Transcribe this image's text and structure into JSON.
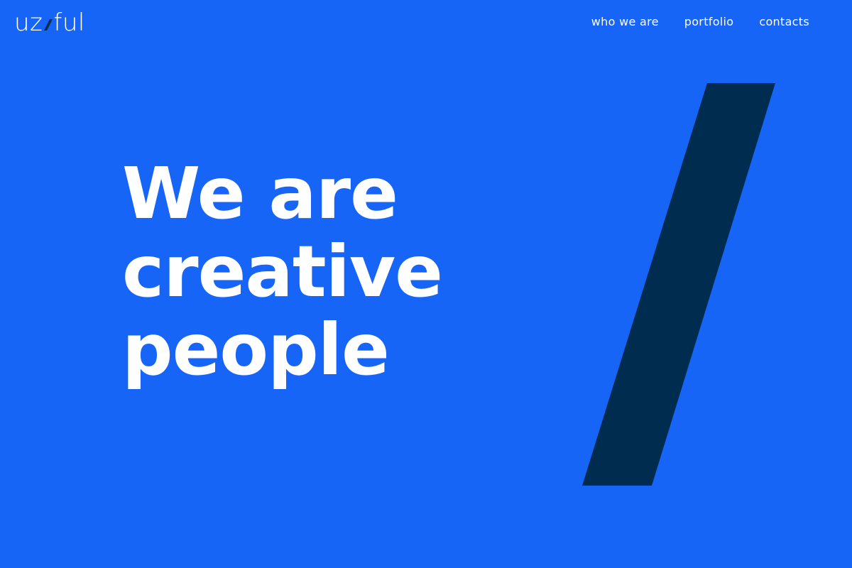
{
  "brand": {
    "logo_left": "uz",
    "logo_right": "ful",
    "accent_color": "#1765f7",
    "slash_color": "#002d4f"
  },
  "nav": {
    "items": [
      {
        "label": "who we are"
      },
      {
        "label": "portfolio"
      },
      {
        "label": "contacts"
      }
    ]
  },
  "hero": {
    "lines": [
      "We are",
      "creative",
      "people"
    ]
  },
  "decor": {
    "icon": "slash-graphic"
  }
}
